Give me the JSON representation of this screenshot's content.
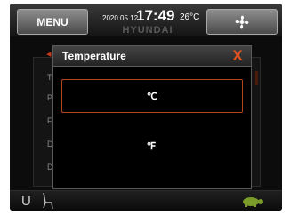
{
  "header": {
    "menu_label": "MENU",
    "date": "2020.05.12",
    "time": "17:49",
    "outside_temp": "26°C",
    "brand": "HYUNDAI",
    "fan_icon": "fan-icon"
  },
  "background_menu": {
    "rows": [
      "T",
      "P",
      "F",
      "D",
      "D"
    ]
  },
  "dialog": {
    "title": "Temperature",
    "close_label": "X",
    "options": [
      {
        "label": "℃",
        "selected": true
      },
      {
        "label": "℉",
        "selected": false
      }
    ]
  },
  "bottom_bar": {
    "left_label": "U",
    "seat_icon": "seat-icon",
    "turtle_icon": "turtle-icon"
  },
  "colors": {
    "accent": "#e2521e",
    "selection_border": "#b5451b",
    "turtle": "#7a9a2a"
  }
}
